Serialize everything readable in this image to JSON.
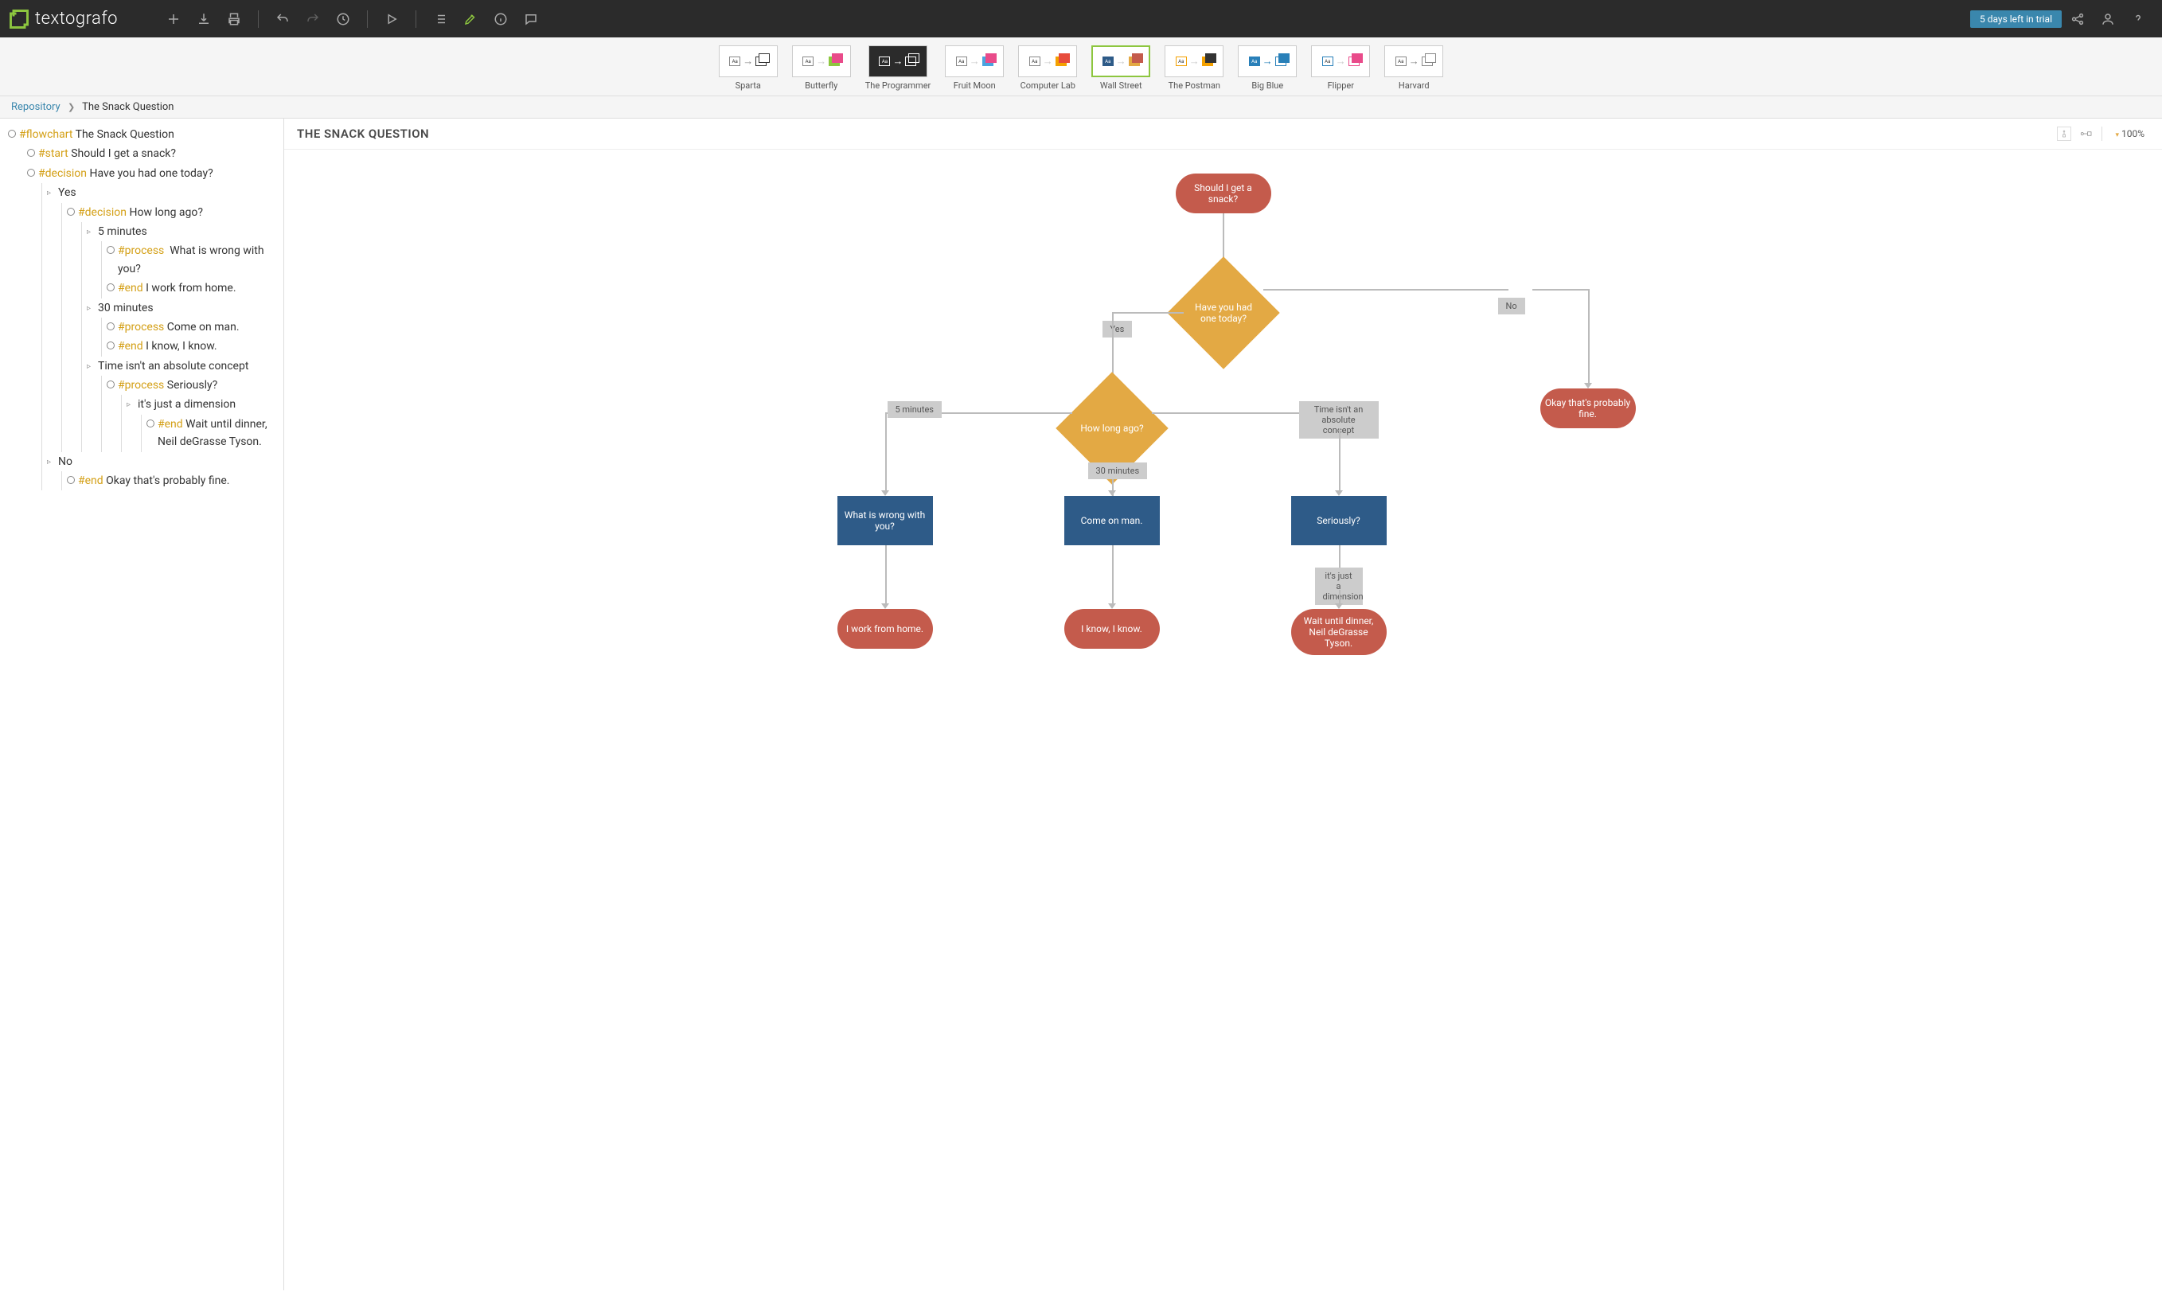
{
  "app": {
    "name": "textografo"
  },
  "trial": {
    "text": "5 days left in trial"
  },
  "themes": [
    {
      "label": "Sparta"
    },
    {
      "label": "Butterfly"
    },
    {
      "label": "The Programmer"
    },
    {
      "label": "Fruit Moon"
    },
    {
      "label": "Computer Lab"
    },
    {
      "label": "Wall Street"
    },
    {
      "label": "The Postman"
    },
    {
      "label": "Big Blue"
    },
    {
      "label": "Flipper"
    },
    {
      "label": "Harvard"
    }
  ],
  "breadcrumb": {
    "root": "Repository",
    "current": "The Snack Question"
  },
  "canvas": {
    "title": "THE SNACK QUESTION",
    "zoom": "100%"
  },
  "outline": {
    "l0": {
      "k": "#flowchart",
      "t": "The Snack Question"
    },
    "l1a": {
      "k": "#start",
      "t": "Should I get a snack?"
    },
    "l1b": {
      "k": "#decision",
      "t": "Have you had one today?"
    },
    "l2a": {
      "t": "Yes"
    },
    "l3a": {
      "k": "#decision",
      "t": "How long ago?"
    },
    "l4a": {
      "t": "5 minutes"
    },
    "l5a": {
      "k": "#process",
      "t": "What is wrong with you?"
    },
    "l5b": {
      "k": "#end",
      "t": "I work from home."
    },
    "l4b": {
      "t": "30 minutes"
    },
    "l5c": {
      "k": "#process",
      "t": "Come on man."
    },
    "l5d": {
      "k": "#end",
      "t": "I know, I know."
    },
    "l4c": {
      "t": "Time isn't an absolute concept"
    },
    "l5e": {
      "k": "#process",
      "t": "Seriously?"
    },
    "l6a": {
      "t": "it's just a dimension"
    },
    "l7a": {
      "k": "#end",
      "t": "Wait until dinner, Neil deGrasse Tyson."
    },
    "l2b": {
      "t": "No"
    },
    "l3b": {
      "k": "#end",
      "t": "Okay that's probably fine."
    }
  },
  "nodes": {
    "start": "Should I get a snack?",
    "d1": "Have you had one today?",
    "d2": "How long ago?",
    "p1": "What is wrong with you?",
    "p2": "Come on man.",
    "p3": "Seriously?",
    "e1": "I work from home.",
    "e2": "I know, I know.",
    "e3": "Wait until dinner, Neil deGrasse Tyson.",
    "e4": "Okay that's probably fine.",
    "lab_yes": "Yes",
    "lab_no": "No",
    "lab_5": "5 minutes",
    "lab_30": "30 minutes",
    "lab_time": "Time isn't an absolute concept",
    "lab_dim": "it's just a dimension"
  }
}
